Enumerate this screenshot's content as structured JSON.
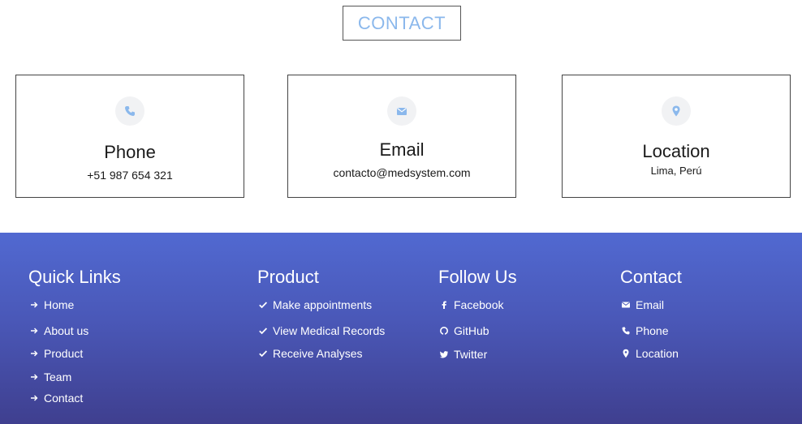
{
  "section_heading": "CONTACT",
  "cards": {
    "phone": {
      "title": "Phone",
      "value": "+51 987 654 321"
    },
    "email": {
      "title": "Email",
      "value": "contacto@medsystem.com"
    },
    "location": {
      "title": "Location",
      "value": "Lima, Perú"
    }
  },
  "colors": {
    "accent": "#8bb8ec",
    "footer_top": "#5169d1",
    "footer_bottom": "#3f3f8f"
  },
  "footer": {
    "quick_links": {
      "title": "Quick Links",
      "items": [
        "Home",
        "About us",
        "Product",
        "Team",
        "Contact"
      ]
    },
    "product": {
      "title": "Product",
      "items": [
        "Make appointments",
        "View Medical Records",
        "Receive Analyses"
      ]
    },
    "follow_us": {
      "title": "Follow Us",
      "items": [
        "Facebook",
        "GitHub",
        "Twitter"
      ]
    },
    "contact": {
      "title": "Contact",
      "items": [
        "Email",
        "Phone",
        "Location"
      ]
    }
  }
}
